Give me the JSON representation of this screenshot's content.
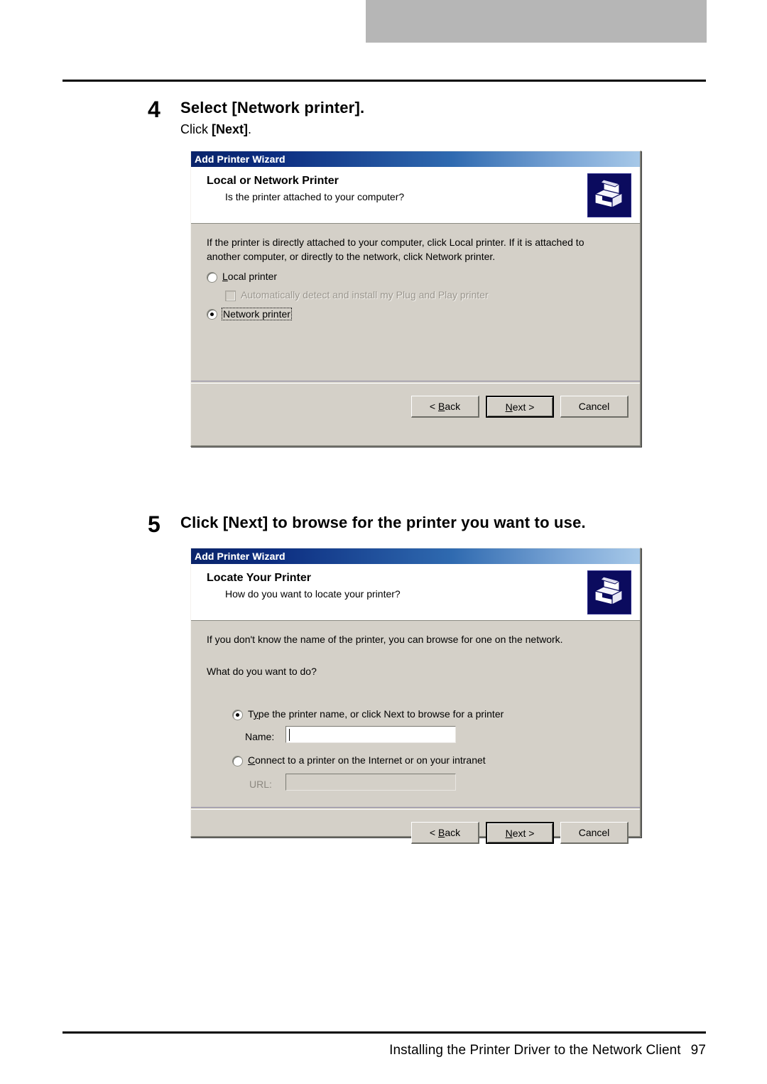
{
  "document": {
    "footer_text": "Installing the Printer Driver to the Network Client",
    "page_number": "97"
  },
  "steps": [
    {
      "number": "4",
      "title": "Select [Network printer].",
      "sub_prefix": "Click ",
      "sub_bold": "[Next]",
      "sub_suffix": "."
    },
    {
      "number": "5",
      "title": "Click [Next] to browse for the printer you want to use."
    }
  ],
  "dialog1": {
    "titlebar": "Add Printer Wizard",
    "banner_title": "Local or Network Printer",
    "banner_sub": "Is the printer attached to your computer?",
    "icon_name": "printer-icon",
    "paragraph_line1": "If the printer is directly attached to your computer, click Local printer.  If it is attached to",
    "paragraph_line2": "another computer, or directly to the network, click Network printer.",
    "option_local": "Local printer",
    "option_local_underline": "L",
    "option_autodetect": "Automatically detect and install my Plug and Play printer",
    "option_network": "Network printer",
    "buttons": {
      "back": "< Back",
      "next": "Next >",
      "cancel": "Cancel"
    }
  },
  "dialog2": {
    "titlebar": "Add Printer Wizard",
    "banner_title": "Locate Your Printer",
    "banner_sub": "How do you want to locate your printer?",
    "icon_name": "printer-icon",
    "paragraph1": "If you don't know the name of the printer, you can browse for one on the network.",
    "paragraph2": "What do you want to do?",
    "option_type_name": "Type the printer name, or click Next to browse for a printer",
    "label_name": "Name:",
    "value_name": "",
    "option_connect_internet": "Connect to a printer on the Internet or on your intranet",
    "label_url": "URL:",
    "value_url": "",
    "buttons": {
      "back": "< Back",
      "next": "Next >",
      "cancel": "Cancel"
    }
  },
  "colors": {
    "titlebar_start": "#0a246a",
    "titlebar_end": "#a6c8e8",
    "dialog_face": "#d4d0c8",
    "icon_background": "#0b0b5e",
    "tab_bar": "#b6b6b6"
  }
}
